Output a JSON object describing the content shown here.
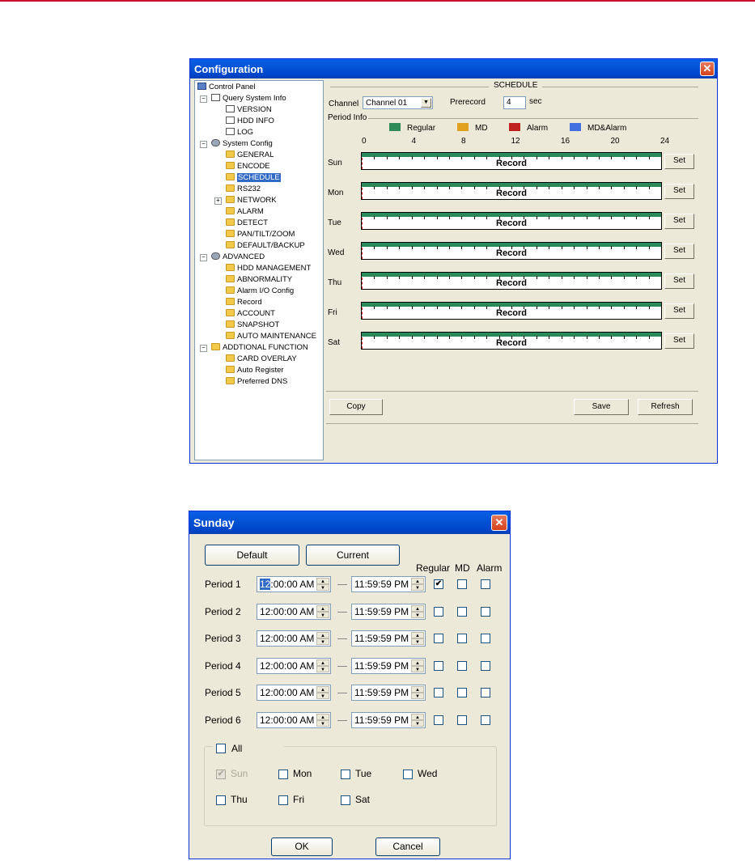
{
  "config_window": {
    "title": "Configuration",
    "close_glyph": "✕",
    "tree": [
      {
        "label": "Control Panel",
        "icon": "pc-icon"
      },
      {
        "label": "Query System Info",
        "icon": "doc-icon"
      },
      {
        "label": "VERSION",
        "icon": "doc-icon"
      },
      {
        "label": "HDD INFO",
        "icon": "doc-icon"
      },
      {
        "label": "LOG",
        "icon": "doc-icon"
      },
      {
        "label": "System Config",
        "icon": "config-icon"
      },
      {
        "label": "GENERAL",
        "icon": "folder-icon"
      },
      {
        "label": "ENCODE",
        "icon": "folder-icon"
      },
      {
        "label": "SCHEDULE",
        "icon": "folder-icon",
        "selected": true
      },
      {
        "label": "RS232",
        "icon": "folder-icon"
      },
      {
        "label": "NETWORK",
        "icon": "folder-icon"
      },
      {
        "label": "ALARM",
        "icon": "folder-icon"
      },
      {
        "label": "DETECT",
        "icon": "folder-icon"
      },
      {
        "label": "PAN/TILT/ZOOM",
        "icon": "folder-icon"
      },
      {
        "label": "DEFAULT/BACKUP",
        "icon": "folder-icon"
      },
      {
        "label": "ADVANCED",
        "icon": "config-icon"
      },
      {
        "label": "HDD MANAGEMENT",
        "icon": "folder-icon"
      },
      {
        "label": "ABNORMALITY",
        "icon": "folder-icon"
      },
      {
        "label": "Alarm I/O Config",
        "icon": "folder-icon"
      },
      {
        "label": "Record",
        "icon": "folder-icon"
      },
      {
        "label": "ACCOUNT",
        "icon": "folder-icon"
      },
      {
        "label": "SNAPSHOT",
        "icon": "folder-icon"
      },
      {
        "label": "AUTO MAINTENANCE",
        "icon": "folder-icon"
      },
      {
        "label": "ADDTIONAL FUNCTION",
        "icon": "folder-icon"
      },
      {
        "label": "CARD OVERLAY",
        "icon": "folder-icon"
      },
      {
        "label": "Auto Register",
        "icon": "folder-icon"
      },
      {
        "label": "Preferred DNS",
        "icon": "folder-icon"
      }
    ],
    "schedule": {
      "section_title": "SCHEDULE",
      "channel_label": "Channel",
      "channel_value": "Channel 01",
      "prerecord_label": "Prerecord",
      "prerecord_value": "4",
      "prerecord_unit": "sec",
      "period_info_label": "Period Info",
      "legend": [
        {
          "label": "Regular",
          "color": "#2e8b57"
        },
        {
          "label": "MD",
          "color": "#e0a020"
        },
        {
          "label": "Alarm",
          "color": "#c02020"
        },
        {
          "label": "MD&Alarm",
          "color": "#4070e0"
        }
      ],
      "hour_ticks": [
        "0",
        "4",
        "8",
        "12",
        "16",
        "20",
        "24"
      ],
      "days": [
        {
          "label": "Sun",
          "bar_text": "Record",
          "set_label": "Set"
        },
        {
          "label": "Mon",
          "bar_text": "Record",
          "set_label": "Set"
        },
        {
          "label": "Tue",
          "bar_text": "Record",
          "set_label": "Set"
        },
        {
          "label": "Wed",
          "bar_text": "Record",
          "set_label": "Set"
        },
        {
          "label": "Thu",
          "bar_text": "Record",
          "set_label": "Set"
        },
        {
          "label": "Fri",
          "bar_text": "Record",
          "set_label": "Set"
        },
        {
          "label": "Sat",
          "bar_text": "Record",
          "set_label": "Set"
        }
      ],
      "copy_label": "Copy",
      "save_label": "Save",
      "refresh_label": "Refresh"
    }
  },
  "sunday_dialog": {
    "title": "Sunday",
    "close_glyph": "✕",
    "default_label": "Default",
    "current_label": "Current",
    "col_regular": "Regular",
    "col_md": "MD",
    "col_alarm": "Alarm",
    "periods": [
      {
        "label": "Period 1",
        "start_hl": "12",
        "start_rest": ":00:00 AM",
        "end": "11:59:59 PM",
        "regular": true,
        "md": false,
        "alarm": false
      },
      {
        "label": "Period 2",
        "start_hl": "",
        "start_rest": "12:00:00 AM",
        "end": "11:59:59 PM",
        "regular": false,
        "md": false,
        "alarm": false
      },
      {
        "label": "Period 3",
        "start_hl": "",
        "start_rest": "12:00:00 AM",
        "end": "11:59:59 PM",
        "regular": false,
        "md": false,
        "alarm": false
      },
      {
        "label": "Period 4",
        "start_hl": "",
        "start_rest": "12:00:00 AM",
        "end": "11:59:59 PM",
        "regular": false,
        "md": false,
        "alarm": false
      },
      {
        "label": "Period 5",
        "start_hl": "",
        "start_rest": "12:00:00 AM",
        "end": "11:59:59 PM",
        "regular": false,
        "md": false,
        "alarm": false
      },
      {
        "label": "Period 6",
        "start_hl": "",
        "start_rest": "12:00:00 AM",
        "end": "11:59:59 PM",
        "regular": false,
        "md": false,
        "alarm": false
      }
    ],
    "all_label": "All",
    "day_checks": [
      {
        "label": "Sun",
        "checked": true,
        "disabled": true
      },
      {
        "label": "Mon",
        "checked": false,
        "disabled": false
      },
      {
        "label": "Tue",
        "checked": false,
        "disabled": false
      },
      {
        "label": "Wed",
        "checked": false,
        "disabled": false
      },
      {
        "label": "Thu",
        "checked": false,
        "disabled": false
      },
      {
        "label": "Fri",
        "checked": false,
        "disabled": false
      },
      {
        "label": "Sat",
        "checked": false,
        "disabled": false
      }
    ],
    "ok_label": "OK",
    "cancel_label": "Cancel"
  }
}
